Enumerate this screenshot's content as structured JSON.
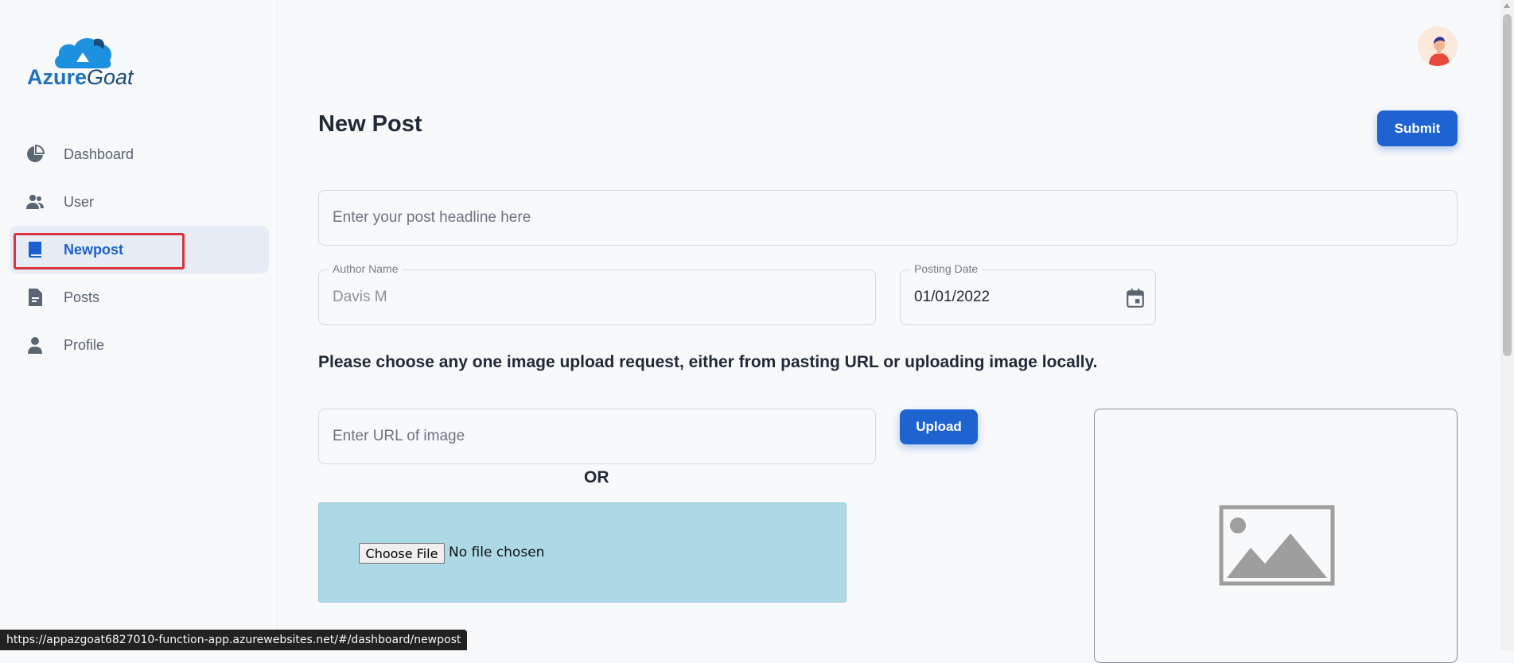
{
  "logo": {
    "part1": "Azure",
    "part2": "Goat"
  },
  "sidebar": {
    "items": [
      {
        "label": "Dashboard",
        "icon": "pie-chart-icon"
      },
      {
        "label": "User",
        "icon": "users-icon"
      },
      {
        "label": "Newpost",
        "icon": "book-icon",
        "active": true
      },
      {
        "label": "Posts",
        "icon": "document-icon"
      },
      {
        "label": "Profile",
        "icon": "person-icon"
      }
    ]
  },
  "main": {
    "title": "New Post",
    "submit_label": "Submit",
    "headline": {
      "placeholder": "Enter your post headline here",
      "value": ""
    },
    "author": {
      "legend": "Author Name",
      "value": "Davis M"
    },
    "posting_date": {
      "legend": "Posting Date",
      "value": "01/01/2022",
      "icon": "calendar-icon"
    },
    "instruction": "Please choose any one image upload request, either from pasting URL or uploading image locally.",
    "url": {
      "placeholder": "Enter URL of image",
      "value": ""
    },
    "upload_label": "Upload",
    "or_text": "OR",
    "file": {
      "button_label": "Choose File",
      "status": "No file chosen"
    },
    "preview_icon": "image-placeholder-icon"
  },
  "status_url": "https://appazgoat6827010-function-app.azurewebsites.net/#/dashboard/newpost",
  "colors": {
    "accent": "#1e63cf",
    "active_bg": "#e7edf7",
    "highlight_outline": "#d9333f",
    "file_area_bg": "#add8e6",
    "page_bg": "#f8f9fb"
  }
}
